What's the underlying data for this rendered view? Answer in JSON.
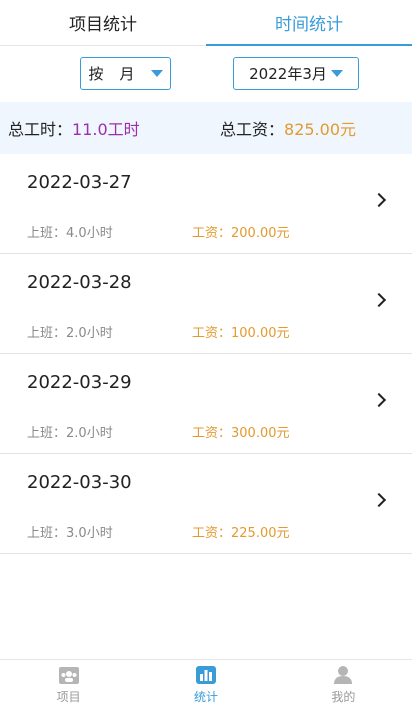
{
  "tabs": [
    {
      "label": "项目统计"
    },
    {
      "label": "时间统计"
    }
  ],
  "filters": {
    "unit": "按月",
    "month": "2022年3月"
  },
  "summary": {
    "hours_label": "总工时：",
    "hours_value": "11.0工时",
    "wage_label": "总工资：",
    "wage_value": "825.00元"
  },
  "rows": [
    {
      "date": "2022-03-27",
      "work_label": "上班：",
      "work_value": "4.0小时",
      "wage_label": "工资：",
      "wage_value": "200.00元"
    },
    {
      "date": "2022-03-28",
      "work_label": "上班：",
      "work_value": "2.0小时",
      "wage_label": "工资：",
      "wage_value": "100.00元"
    },
    {
      "date": "2022-03-29",
      "work_label": "上班：",
      "work_value": "2.0小时",
      "wage_label": "工资：",
      "wage_value": "300.00元"
    },
    {
      "date": "2022-03-30",
      "work_label": "上班：",
      "work_value": "3.0小时",
      "wage_label": "工资：",
      "wage_value": "225.00元"
    }
  ],
  "nav": [
    {
      "label": "项目",
      "icon": "project-icon"
    },
    {
      "label": "统计",
      "icon": "stats-icon"
    },
    {
      "label": "我的",
      "icon": "user-icon"
    }
  ],
  "colors": {
    "accent": "#3a9bd9",
    "hours": "#9b2fae",
    "wage": "#e39a2f"
  }
}
